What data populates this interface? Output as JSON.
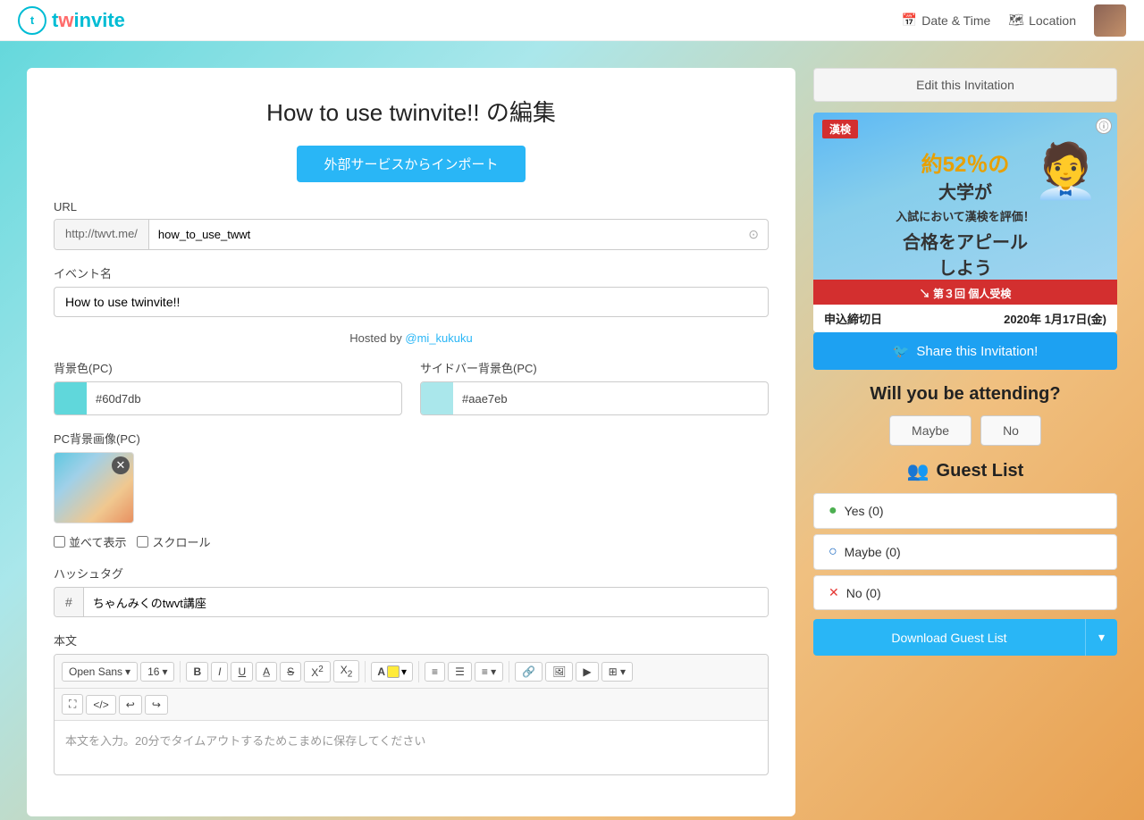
{
  "header": {
    "logo_text_t": "t",
    "logo_text_rest": "winvite",
    "nav_datetime": "Date & Time",
    "nav_location": "Location"
  },
  "page": {
    "title": "How to use twinvite!! の編集",
    "import_button": "外部サービスからインポート",
    "url_label": "URL",
    "url_prefix": "http://twvt.me/",
    "url_value": "how_to_use_twwt",
    "event_name_label": "イベント名",
    "event_name_value": "How to use twinvite!!",
    "hosted_by_text": "Hosted by ",
    "hosted_by_user": "@mi_kukuku",
    "bg_color_label": "背景色(PC)",
    "bg_color_value": "#60d7db",
    "sidebar_color_label": "サイドバー背景色(PC)",
    "sidebar_color_value": "#aae7eb",
    "bg_image_label": "PC背景画像(PC)",
    "tile_label": "並べて表示",
    "scroll_label": "スクロール",
    "hashtag_label": "ハッシュタグ",
    "hashtag_prefix": "#",
    "hashtag_value": "ちゃんみくのtwvt講座",
    "body_label": "本文",
    "editor_font": "Open Sans",
    "editor_size": "16",
    "editor_placeholder": "本文を入力。20分でタイムアウトするためこまめに保存してください",
    "toolbar_bold": "B",
    "toolbar_italic": "I",
    "toolbar_underline": "U",
    "toolbar_strikethrough": "S",
    "toolbar_sup": "X²",
    "toolbar_sub": "X₂"
  },
  "sidebar": {
    "edit_btn": "Edit this Invitation",
    "share_btn": "Share this Invitation!",
    "attending_title": "Will you be attending?",
    "maybe_btn": "Maybe",
    "no_btn": "No",
    "guest_list_title": "Guest List",
    "guest_yes": "Yes (0)",
    "guest_maybe": "Maybe (0)",
    "guest_no": "No (0)",
    "download_btn": "Download Guest List",
    "ad_kanji_badge": "漢検",
    "ad_line1": "約52％の",
    "ad_line2": "大学が",
    "ad_line3": "入試において漢検を評価！",
    "ad_line4": "合格をアピール",
    "ad_line5": "しよう",
    "ad_bottom_label": "第３回 個人受検",
    "ad_deadline": "申込締切日",
    "ad_date": "2020年 1月17日(金)"
  },
  "colors": {
    "bg_color": "#60d7db",
    "sidebar_color": "#aae7eb",
    "accent_blue": "#29b6f6",
    "twitter_blue": "#1da1f2"
  }
}
